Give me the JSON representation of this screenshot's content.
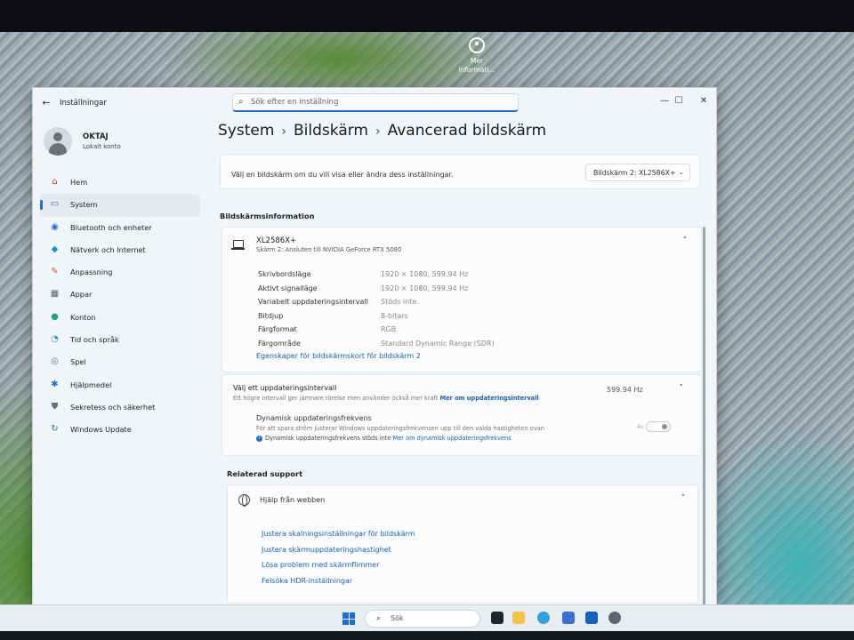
{
  "desktop": {
    "icon_label_line1": "Mer",
    "icon_label_line2": "informati..."
  },
  "window": {
    "app_title": "Inställningar",
    "search_placeholder": "Sök efter en inställning",
    "controls": {
      "minimize": "—",
      "maximize": "☐",
      "close": "✕"
    }
  },
  "user": {
    "name": "OKTAJ",
    "account_type": "Lokalt konto"
  },
  "sidebar": {
    "items": [
      {
        "label": "Hem",
        "icon": "home-icon",
        "glyph": "⌂",
        "color": "#d4442b",
        "active": false
      },
      {
        "label": "System",
        "icon": "system-icon",
        "glyph": "▭",
        "color": "#1d6fd6",
        "active": true
      },
      {
        "label": "Bluetooth och enheter",
        "icon": "bluetooth-icon",
        "glyph": "◉",
        "color": "#1d6fd6",
        "active": false
      },
      {
        "label": "Nätverk och Internet",
        "icon": "network-icon",
        "glyph": "◆",
        "color": "#1d8fd6",
        "active": false
      },
      {
        "label": "Anpassning",
        "icon": "personalize-icon",
        "glyph": "✎",
        "color": "#c8553d",
        "active": false
      },
      {
        "label": "Appar",
        "icon": "apps-icon",
        "glyph": "▦",
        "color": "#5a6470",
        "active": false
      },
      {
        "label": "Konton",
        "icon": "accounts-icon",
        "glyph": "●",
        "color": "#1fa67a",
        "active": false
      },
      {
        "label": "Tid och språk",
        "icon": "time-language-icon",
        "glyph": "◔",
        "color": "#1d8fd6",
        "active": false
      },
      {
        "label": "Spel",
        "icon": "gaming-icon",
        "glyph": "◎",
        "color": "#6b7178",
        "active": false
      },
      {
        "label": "Hjälpmedel",
        "icon": "accessibility-icon",
        "glyph": "✱",
        "color": "#1d6fd6",
        "active": false
      },
      {
        "label": "Sekretess och säkerhet",
        "icon": "shield-icon",
        "glyph": "⛊",
        "color": "#6b7178",
        "active": false
      },
      {
        "label": "Windows Update",
        "icon": "windows-update-icon",
        "glyph": "↻",
        "color": "#1d6fd6",
        "active": false
      }
    ]
  },
  "breadcrumb": {
    "item1": "System",
    "item2": "Bildskärm",
    "current": "Avancerad bildskärm",
    "separator": "›"
  },
  "display_picker": {
    "prompt": "Välj en bildskärm om du vill visa eller ändra dess inställningar.",
    "selected": "Bildskärm 2: XL2586X+"
  },
  "display_info": {
    "section_title": "Bildskärmsinformation",
    "monitor_name": "XL2586X+",
    "monitor_sub": "Skärm 2: Ansluten till NVIDIA GeForce RTX 5080",
    "rows": [
      {
        "label": "Skrivbordsläge",
        "value": "1920 × 1080, 599.94 Hz"
      },
      {
        "label": "Aktivt signalläge",
        "value": "1920 × 1080, 599.94 Hz"
      },
      {
        "label": "Variabelt uppdateringsintervall",
        "value": "Stöds inte"
      },
      {
        "label": "Bitdjup",
        "value": "8-bitars"
      },
      {
        "label": "Färgformat",
        "value": "RGB"
      },
      {
        "label": "Färgområde",
        "value": "Standard Dynamic Range (SDR)"
      }
    ],
    "adapter_link": "Egenskaper för bildskärmskort för bildskärm 2"
  },
  "refresh": {
    "title": "Välj ett uppdateringsintervall",
    "desc": "Ett högre intervall ger jämnare rörelse men använder också mer kraft",
    "more_link": "Mer om uppdateringsintervall",
    "value": "599.94 Hz",
    "dynamic_title": "Dynamisk uppdateringsfrekvens",
    "dynamic_desc": "För att spara ström justerar Windows uppdateringsfrekvensen upp till den valda hastigheten ovan",
    "dynamic_note": "Dynamisk uppdateringsfrekvens stöds inte",
    "dynamic_link": "Mer om dynamisk uppdateringsfrekvens",
    "toggle_label": "Av"
  },
  "support": {
    "section_title": "Relaterad support",
    "help_title": "Hjälp från webben",
    "links": [
      "Justera skalningsinställningar för bildskärm",
      "Justera skärmuppdateringshastighet",
      "Lösa problem med skärmflimmer",
      "Felsöka HDR-inställningar"
    ]
  },
  "taskbar": {
    "search_label": "Sök"
  },
  "colors": {
    "accent": "#1d6fd6",
    "link": "#1a5fb4",
    "window_bg": "#f2f5f8",
    "card_bg": "#fbfcfd"
  }
}
